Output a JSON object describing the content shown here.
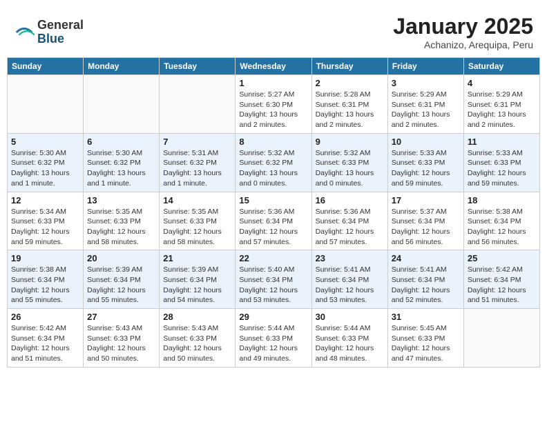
{
  "header": {
    "logo_general": "General",
    "logo_blue": "Blue",
    "month_title": "January 2025",
    "location": "Achanizo, Arequipa, Peru"
  },
  "weekdays": [
    "Sunday",
    "Monday",
    "Tuesday",
    "Wednesday",
    "Thursday",
    "Friday",
    "Saturday"
  ],
  "weeks": [
    [
      {
        "day": "",
        "info": ""
      },
      {
        "day": "",
        "info": ""
      },
      {
        "day": "",
        "info": ""
      },
      {
        "day": "1",
        "info": "Sunrise: 5:27 AM\nSunset: 6:30 PM\nDaylight: 13 hours\nand 2 minutes."
      },
      {
        "day": "2",
        "info": "Sunrise: 5:28 AM\nSunset: 6:31 PM\nDaylight: 13 hours\nand 2 minutes."
      },
      {
        "day": "3",
        "info": "Sunrise: 5:29 AM\nSunset: 6:31 PM\nDaylight: 13 hours\nand 2 minutes."
      },
      {
        "day": "4",
        "info": "Sunrise: 5:29 AM\nSunset: 6:31 PM\nDaylight: 13 hours\nand 2 minutes."
      }
    ],
    [
      {
        "day": "5",
        "info": "Sunrise: 5:30 AM\nSunset: 6:32 PM\nDaylight: 13 hours\nand 1 minute."
      },
      {
        "day": "6",
        "info": "Sunrise: 5:30 AM\nSunset: 6:32 PM\nDaylight: 13 hours\nand 1 minute."
      },
      {
        "day": "7",
        "info": "Sunrise: 5:31 AM\nSunset: 6:32 PM\nDaylight: 13 hours\nand 1 minute."
      },
      {
        "day": "8",
        "info": "Sunrise: 5:32 AM\nSunset: 6:32 PM\nDaylight: 13 hours\nand 0 minutes."
      },
      {
        "day": "9",
        "info": "Sunrise: 5:32 AM\nSunset: 6:33 PM\nDaylight: 13 hours\nand 0 minutes."
      },
      {
        "day": "10",
        "info": "Sunrise: 5:33 AM\nSunset: 6:33 PM\nDaylight: 12 hours\nand 59 minutes."
      },
      {
        "day": "11",
        "info": "Sunrise: 5:33 AM\nSunset: 6:33 PM\nDaylight: 12 hours\nand 59 minutes."
      }
    ],
    [
      {
        "day": "12",
        "info": "Sunrise: 5:34 AM\nSunset: 6:33 PM\nDaylight: 12 hours\nand 59 minutes."
      },
      {
        "day": "13",
        "info": "Sunrise: 5:35 AM\nSunset: 6:33 PM\nDaylight: 12 hours\nand 58 minutes."
      },
      {
        "day": "14",
        "info": "Sunrise: 5:35 AM\nSunset: 6:33 PM\nDaylight: 12 hours\nand 58 minutes."
      },
      {
        "day": "15",
        "info": "Sunrise: 5:36 AM\nSunset: 6:34 PM\nDaylight: 12 hours\nand 57 minutes."
      },
      {
        "day": "16",
        "info": "Sunrise: 5:36 AM\nSunset: 6:34 PM\nDaylight: 12 hours\nand 57 minutes."
      },
      {
        "day": "17",
        "info": "Sunrise: 5:37 AM\nSunset: 6:34 PM\nDaylight: 12 hours\nand 56 minutes."
      },
      {
        "day": "18",
        "info": "Sunrise: 5:38 AM\nSunset: 6:34 PM\nDaylight: 12 hours\nand 56 minutes."
      }
    ],
    [
      {
        "day": "19",
        "info": "Sunrise: 5:38 AM\nSunset: 6:34 PM\nDaylight: 12 hours\nand 55 minutes."
      },
      {
        "day": "20",
        "info": "Sunrise: 5:39 AM\nSunset: 6:34 PM\nDaylight: 12 hours\nand 55 minutes."
      },
      {
        "day": "21",
        "info": "Sunrise: 5:39 AM\nSunset: 6:34 PM\nDaylight: 12 hours\nand 54 minutes."
      },
      {
        "day": "22",
        "info": "Sunrise: 5:40 AM\nSunset: 6:34 PM\nDaylight: 12 hours\nand 53 minutes."
      },
      {
        "day": "23",
        "info": "Sunrise: 5:41 AM\nSunset: 6:34 PM\nDaylight: 12 hours\nand 53 minutes."
      },
      {
        "day": "24",
        "info": "Sunrise: 5:41 AM\nSunset: 6:34 PM\nDaylight: 12 hours\nand 52 minutes."
      },
      {
        "day": "25",
        "info": "Sunrise: 5:42 AM\nSunset: 6:34 PM\nDaylight: 12 hours\nand 51 minutes."
      }
    ],
    [
      {
        "day": "26",
        "info": "Sunrise: 5:42 AM\nSunset: 6:34 PM\nDaylight: 12 hours\nand 51 minutes."
      },
      {
        "day": "27",
        "info": "Sunrise: 5:43 AM\nSunset: 6:33 PM\nDaylight: 12 hours\nand 50 minutes."
      },
      {
        "day": "28",
        "info": "Sunrise: 5:43 AM\nSunset: 6:33 PM\nDaylight: 12 hours\nand 50 minutes."
      },
      {
        "day": "29",
        "info": "Sunrise: 5:44 AM\nSunset: 6:33 PM\nDaylight: 12 hours\nand 49 minutes."
      },
      {
        "day": "30",
        "info": "Sunrise: 5:44 AM\nSunset: 6:33 PM\nDaylight: 12 hours\nand 48 minutes."
      },
      {
        "day": "31",
        "info": "Sunrise: 5:45 AM\nSunset: 6:33 PM\nDaylight: 12 hours\nand 47 minutes."
      },
      {
        "day": "",
        "info": ""
      }
    ]
  ]
}
